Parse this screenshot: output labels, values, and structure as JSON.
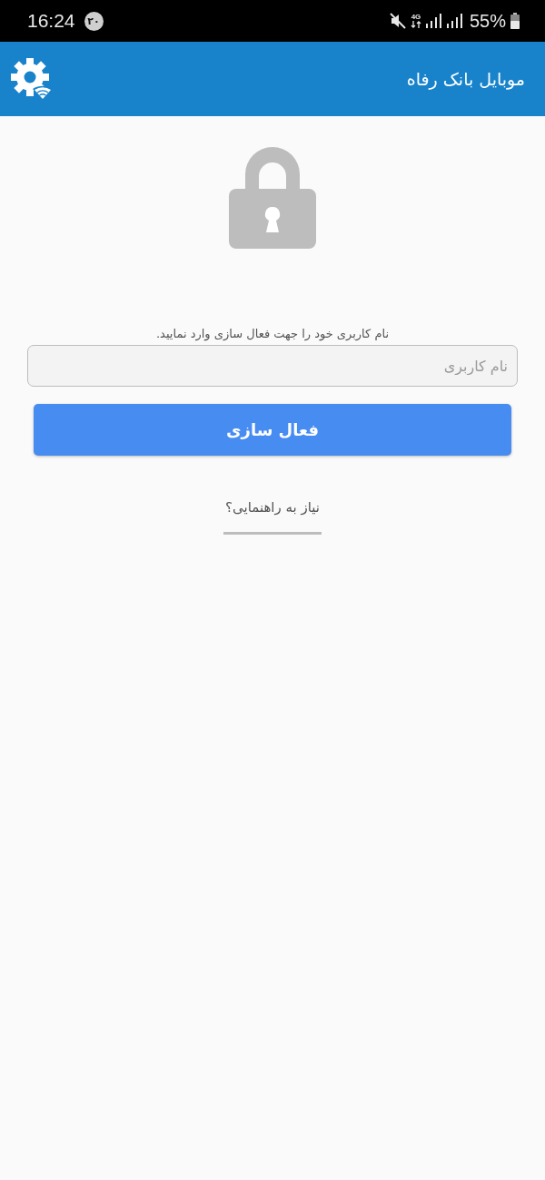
{
  "status_bar": {
    "time": "16:24",
    "badge": "۲۰",
    "network": "4G",
    "battery": "55%"
  },
  "app_bar": {
    "title": "موبایل بانک رفاه"
  },
  "form": {
    "instruction": "نام کاربری خود را جهت فعال سازی وارد نمایید.",
    "username": {
      "placeholder": "نام کاربری"
    },
    "submit": "فعال سازی",
    "help_link": "نیاز به راهنمایی؟"
  }
}
